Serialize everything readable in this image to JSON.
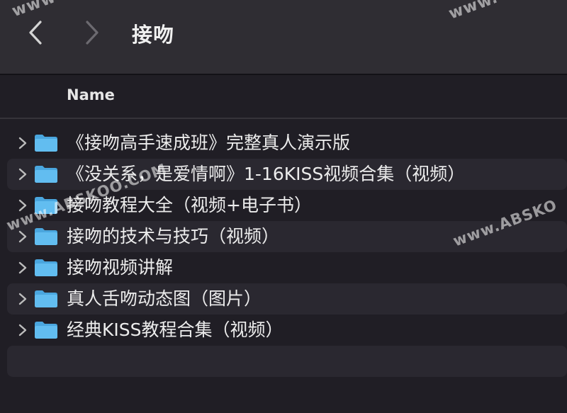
{
  "window": {
    "title": "接吻"
  },
  "columns": {
    "name": "Name"
  },
  "items": [
    {
      "label": "《接吻高手速成班》完整真人演示版"
    },
    {
      "label": "《没关系，是爱情啊》1-16KISS视频合集（视频）"
    },
    {
      "label": "接吻教程大全（视频+电子书）"
    },
    {
      "label": "接吻的技术与技巧（视频）"
    },
    {
      "label": "接吻视频讲解"
    },
    {
      "label": "真人舌吻动态图（图片）"
    },
    {
      "label": "经典KISS教程合集（视频）"
    }
  ],
  "watermarks": {
    "top_left": "www",
    "top_right": "www.",
    "mid_left": "www.ABSKOO.COM",
    "mid_right": "www.ABSKO"
  },
  "icons": {
    "back": "chevron-left-icon",
    "forward": "chevron-right-icon",
    "disclosure": "chevron-right-icon",
    "folder": "folder-icon"
  },
  "colors": {
    "background": "#201e25",
    "titlebar": "#2f2d33",
    "row_alt": "#2a2830",
    "folder": "#5ab4ea"
  }
}
